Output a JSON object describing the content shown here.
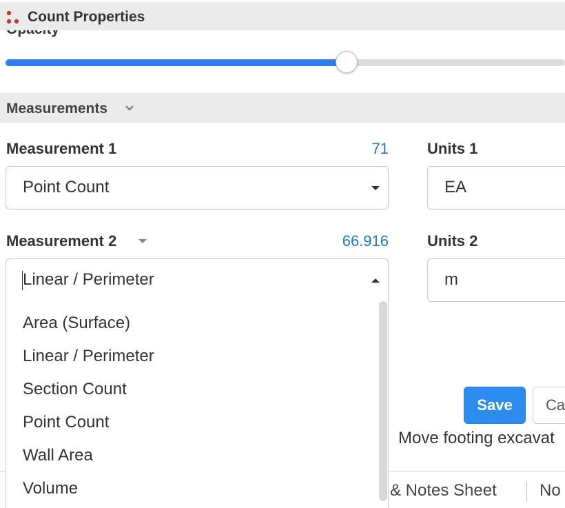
{
  "panel": {
    "title": "Count Properties",
    "icon": "count-dots-icon",
    "icon_color": "#c0392b"
  },
  "opacity": {
    "label": "Opacity",
    "value_fraction": 0.61,
    "accent": "#2f80ed"
  },
  "measurements": {
    "section_label": "Measurements",
    "m1": {
      "label": "Measurement 1",
      "value": "71",
      "selected": "Point Count"
    },
    "u1": {
      "label": "Units 1",
      "value": "EA"
    },
    "m2": {
      "label": "Measurement 2",
      "value": "66.916",
      "selected": "Linear / Perimeter"
    },
    "u2": {
      "label": "Units 2",
      "value": "m"
    },
    "options": [
      "Area (Surface)",
      "Linear / Perimeter",
      "Section Count",
      "Point Count",
      "Wall Area",
      "Volume"
    ]
  },
  "actions": {
    "save_label": "Save",
    "cancel_label": "Ca"
  },
  "background": {
    "note_text": "Move footing excavat",
    "tab_notes": "& Notes Sheet",
    "tab_next": "No"
  },
  "colors": {
    "value_blue": "#1f78c8",
    "save_blue": "#2d8cf0",
    "header_gray": "#ebebeb"
  }
}
